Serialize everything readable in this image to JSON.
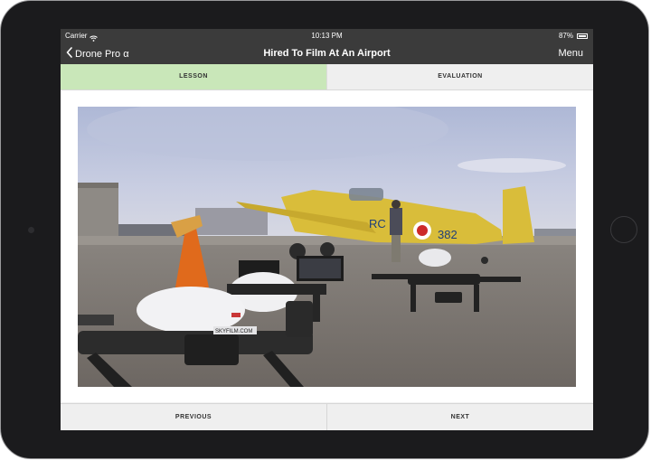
{
  "status_bar": {
    "carrier": "Carrier",
    "time": "10:13 PM",
    "battery": "87%"
  },
  "nav": {
    "back_label": "Drone Pro α",
    "title": "Hired To Film At An Airport",
    "menu_label": "Menu"
  },
  "tabs": [
    {
      "label": "LESSON",
      "active": true
    },
    {
      "label": "EVALUATION",
      "active": false
    }
  ],
  "photo": {
    "aircraft_marking": "382",
    "aircraft_marking_prefix": "RC",
    "drone_label": "SKYFILM.COM"
  },
  "footer": {
    "previous_label": "PREVIOUS",
    "next_label": "NEXT"
  },
  "colors": {
    "nav_background": "#3b3b3b",
    "active_tab": "#c9e7b9",
    "device_bezel": "#1b1b1d"
  }
}
